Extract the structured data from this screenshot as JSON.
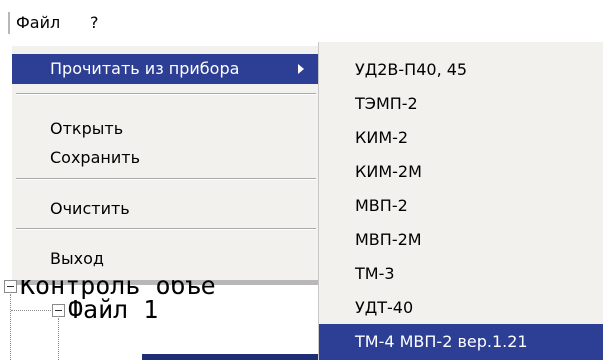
{
  "menubar": {
    "file_label": "Файл",
    "help_label": "?"
  },
  "file_menu": {
    "items": [
      {
        "label": "Прочитать из прибора"
      },
      {
        "label": "Открыть"
      },
      {
        "label": "Сохранить"
      },
      {
        "label": "Очистить"
      },
      {
        "label": "Выход"
      }
    ],
    "highlighted": "Прочитать из прибора"
  },
  "submenu": {
    "items": [
      {
        "label": "УД2В-П40, 45"
      },
      {
        "label": "ТЭМП-2"
      },
      {
        "label": "КИМ-2"
      },
      {
        "label": "КИМ-2М"
      },
      {
        "label": "МВП-2"
      },
      {
        "label": "МВП-2М"
      },
      {
        "label": "ТМ-3"
      },
      {
        "label": "УДТ-40"
      },
      {
        "label": "ТМ-4 МВП-2 вер.1.21"
      }
    ],
    "highlighted": "ТМ-4 МВП-2 вер.1.21"
  },
  "tree": {
    "root_label": "Контроль объе",
    "child_label": "Файл 1"
  },
  "colors": {
    "highlight": "#2d3e95",
    "menu_bg": "#f2f1ee",
    "tree_selection": "#1e2e75"
  },
  "icons": [
    "submenu-arrow-icon",
    "tree-collapse-icon"
  ]
}
